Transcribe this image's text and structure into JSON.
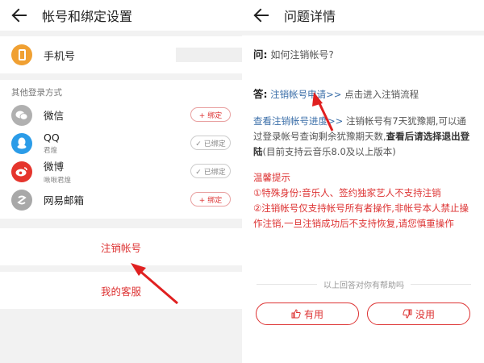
{
  "left": {
    "title": "帐号和绑定设置",
    "phone": {
      "label": "手机号"
    },
    "section_title": "其他登录方式",
    "logins": [
      {
        "name": "微信",
        "sub": "",
        "button": "+ 绑定",
        "bound": false,
        "icon": "wechat-icon"
      },
      {
        "name": "QQ",
        "sub": "君煌",
        "button": "✓ 已绑定",
        "bound": true,
        "icon": "qq-icon"
      },
      {
        "name": "微博",
        "sub": "啾啾君煌",
        "button": "✓ 已绑定",
        "bound": true,
        "icon": "weibo-icon"
      },
      {
        "name": "网易邮箱",
        "sub": "",
        "button": "+ 绑定",
        "bound": false,
        "icon": "mail-icon"
      }
    ],
    "cancel_account": "注销帐号",
    "my_service": "我的客服"
  },
  "right": {
    "title": "问题详情",
    "q_label": "问:",
    "question": "如何注销帐号?",
    "a_label": "答:",
    "answer_link": "注销帐号申请>>",
    "answer_text": "点击进入注销流程",
    "progress_link": "查看注销帐号进度>>",
    "progress_text": "注销帐号有7天犹豫期,可以通过登录帐号查询剩余犹豫期天数,",
    "progress_bold": "查看后请选择退出登陆",
    "progress_tail": "(目前支持云音乐8.0及以上版本)",
    "tips_title": "温馨提示",
    "tip1": "①特殊身份:音乐人、签约独家艺人不支持注销",
    "tip2": "②注销帐号仅支持帐号所有者操作,非帐号本人禁止操作注销,一旦注销成功后不支持恢复,请您慎重操作",
    "helpful_prompt": "以上回答对你有帮助吗",
    "yes": "有用",
    "no": "没用"
  },
  "colors": {
    "accent_red": "#d33333",
    "link_blue": "#3a6ea8",
    "qq_blue": "#2b9ce8",
    "weibo_red": "#e5352d",
    "phone_orange": "#f0a032"
  }
}
